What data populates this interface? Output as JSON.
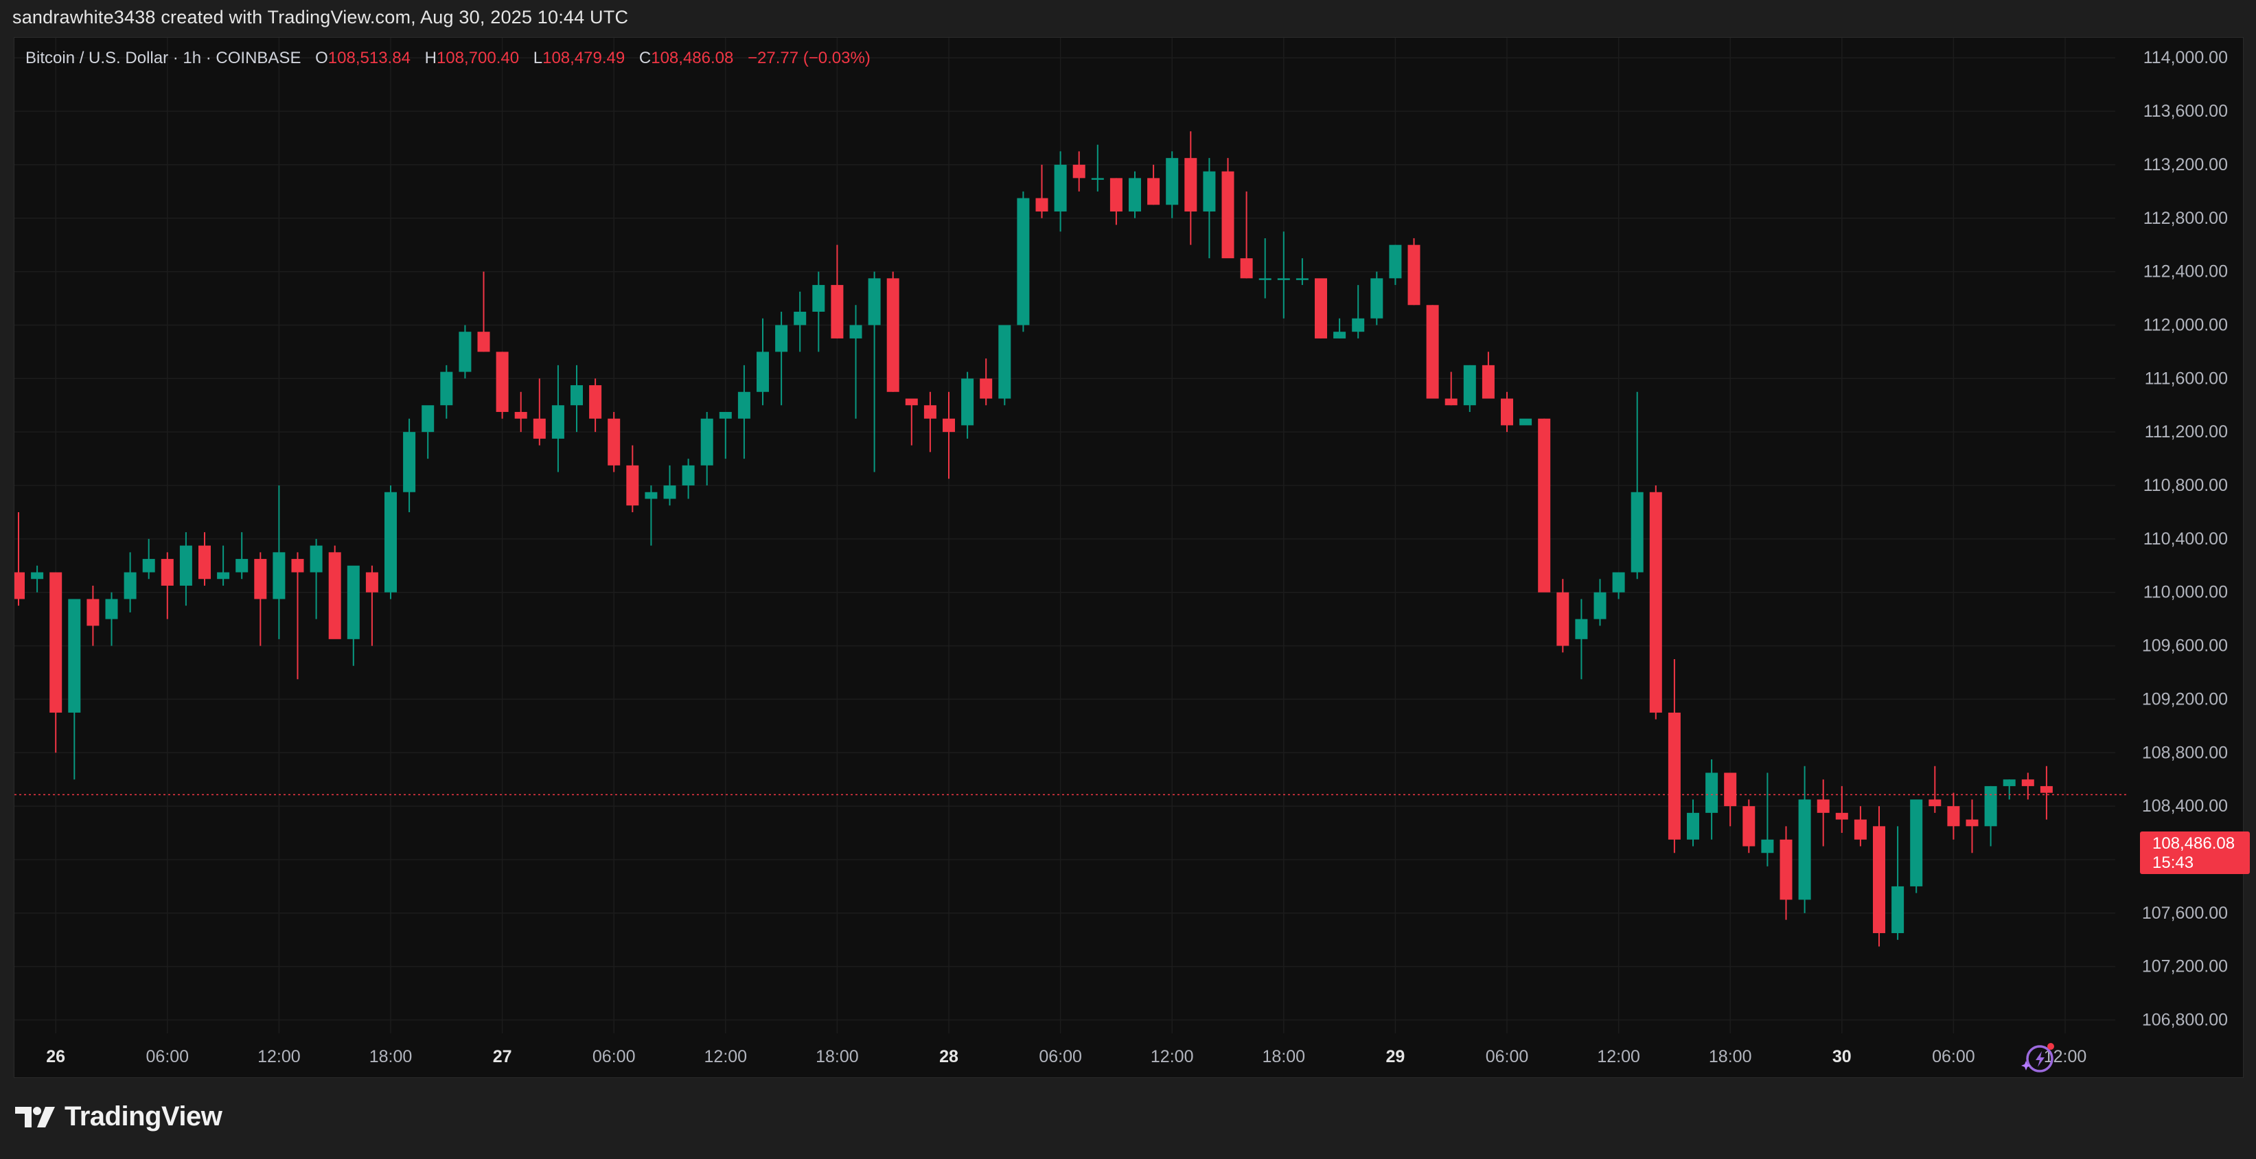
{
  "header": {
    "text": "sandrawhite3438 created with TradingView.com, Aug 30, 2025 10:44 UTC"
  },
  "legend": {
    "symbol": "Bitcoin / U.S. Dollar · 1h · COINBASE",
    "o_label": "O",
    "o_value": "108,513.84",
    "h_label": "H",
    "h_value": "108,700.40",
    "l_label": "L",
    "l_value": "108,479.49",
    "c_label": "C",
    "c_value": "108,486.08",
    "change": "−27.77 (−0.03%)"
  },
  "price_tag": {
    "price": "108,486.08",
    "countdown": "15:43"
  },
  "footer": {
    "logo_text": "TradingView"
  },
  "colors": {
    "up": "#089981",
    "down": "#f23645",
    "background": "#0f0f0f",
    "grid": "#1c1c1c",
    "text": "#b2b5be"
  },
  "icons": {
    "logo": "tradingview-logo-icon",
    "assistant": "sparkle-assistant-icon"
  },
  "chart_data": {
    "type": "candlestick",
    "interval": "1h",
    "last_price": 108486.08,
    "ylim": [
      106700,
      114150
    ],
    "y_ticks": [
      "114,000.00",
      "113,600.00",
      "113,200.00",
      "112,800.00",
      "112,400.00",
      "112,000.00",
      "111,600.00",
      "111,200.00",
      "110,800.00",
      "110,400.00",
      "110,000.00",
      "109,600.00",
      "109,200.00",
      "108,800.00",
      "108,400.00",
      "108,000.00",
      "107,600.00",
      "107,200.00",
      "106,800.00"
    ],
    "x_ticks": [
      {
        "label": "26",
        "bar": 2,
        "bold": true
      },
      {
        "label": "06:00",
        "bar": 8
      },
      {
        "label": "12:00",
        "bar": 14
      },
      {
        "label": "18:00",
        "bar": 20
      },
      {
        "label": "27",
        "bar": 26,
        "bold": true
      },
      {
        "label": "06:00",
        "bar": 32
      },
      {
        "label": "12:00",
        "bar": 38
      },
      {
        "label": "18:00",
        "bar": 44
      },
      {
        "label": "28",
        "bar": 50,
        "bold": true
      },
      {
        "label": "06:00",
        "bar": 56
      },
      {
        "label": "12:00",
        "bar": 62
      },
      {
        "label": "18:00",
        "bar": 68
      },
      {
        "label": "29",
        "bar": 74,
        "bold": true
      },
      {
        "label": "06:00",
        "bar": 80
      },
      {
        "label": "12:00",
        "bar": 86
      },
      {
        "label": "18:00",
        "bar": 92
      },
      {
        "label": "30",
        "bar": 98,
        "bold": true
      },
      {
        "label": "06:00",
        "bar": 104
      },
      {
        "label": "12:00",
        "bar": 110
      }
    ],
    "candles": [
      [
        110150,
        110600,
        109900,
        109950
      ],
      [
        110100,
        110200,
        110000,
        110150
      ],
      [
        110150,
        110150,
        108800,
        109100
      ],
      [
        109100,
        109950,
        108600,
        109950
      ],
      [
        109950,
        110050,
        109600,
        109750
      ],
      [
        109800,
        110000,
        109600,
        109950
      ],
      [
        109950,
        110300,
        109850,
        110150
      ],
      [
        110150,
        110400,
        110100,
        110250
      ],
      [
        110250,
        110300,
        109800,
        110050
      ],
      [
        110050,
        110450,
        109900,
        110350
      ],
      [
        110350,
        110450,
        110050,
        110100
      ],
      [
        110100,
        110350,
        110050,
        110150
      ],
      [
        110150,
        110450,
        110100,
        110250
      ],
      [
        110250,
        110300,
        109600,
        109950
      ],
      [
        109950,
        110800,
        109650,
        110300
      ],
      [
        110250,
        110300,
        109350,
        110150
      ],
      [
        110150,
        110400,
        109800,
        110350
      ],
      [
        110300,
        110350,
        109750,
        109650
      ],
      [
        109650,
        110050,
        109450,
        110200
      ],
      [
        110150,
        110200,
        109600,
        110000
      ],
      [
        110000,
        110800,
        109950,
        110750
      ],
      [
        110750,
        111300,
        110600,
        111200
      ],
      [
        111200,
        111350,
        111000,
        111400
      ],
      [
        111400,
        111700,
        111300,
        111650
      ],
      [
        111650,
        112000,
        111600,
        111950
      ],
      [
        111950,
        112400,
        111800,
        111800
      ],
      [
        111800,
        111800,
        111300,
        111350
      ],
      [
        111350,
        111500,
        111200,
        111300
      ],
      [
        111300,
        111600,
        111100,
        111150
      ],
      [
        111150,
        111700,
        110900,
        111400
      ],
      [
        111400,
        111700,
        111200,
        111550
      ],
      [
        111550,
        111600,
        111200,
        111300
      ],
      [
        111300,
        111350,
        110900,
        110950
      ],
      [
        110950,
        111100,
        110600,
        110650
      ],
      [
        110700,
        110800,
        110350,
        110750
      ],
      [
        110700,
        110950,
        110650,
        110800
      ],
      [
        110800,
        111000,
        110700,
        110950
      ],
      [
        110950,
        111350,
        110800,
        111300
      ],
      [
        111300,
        111350,
        111000,
        111350
      ],
      [
        111300,
        111700,
        111000,
        111500
      ],
      [
        111500,
        112050,
        111400,
        111800
      ],
      [
        111800,
        112100,
        111400,
        112000
      ],
      [
        112000,
        112250,
        111800,
        112100
      ],
      [
        112100,
        112400,
        111800,
        112300
      ],
      [
        112300,
        112600,
        111900,
        111900
      ],
      [
        111900,
        112150,
        111300,
        112000
      ],
      [
        112000,
        112400,
        110900,
        112350
      ],
      [
        112350,
        112400,
        111500,
        111500
      ],
      [
        111450,
        111450,
        111100,
        111400
      ],
      [
        111400,
        111500,
        111050,
        111300
      ],
      [
        111300,
        111500,
        110850,
        111200
      ],
      [
        111250,
        111650,
        111150,
        111600
      ],
      [
        111600,
        111750,
        111400,
        111450
      ],
      [
        111450,
        112000,
        111400,
        112000
      ],
      [
        112000,
        113000,
        111950,
        112950
      ],
      [
        112950,
        113200,
        112800,
        112850
      ],
      [
        112850,
        113300,
        112700,
        113200
      ],
      [
        113200,
        113300,
        113000,
        113100
      ],
      [
        113100,
        113350,
        113000,
        113100
      ],
      [
        113100,
        113100,
        112750,
        112850
      ],
      [
        112850,
        113150,
        112800,
        113100
      ],
      [
        113100,
        113200,
        112900,
        112900
      ],
      [
        112900,
        113300,
        112800,
        113250
      ],
      [
        113250,
        113450,
        112600,
        112850
      ],
      [
        112850,
        113250,
        112500,
        113150
      ],
      [
        113150,
        113250,
        112550,
        112500
      ],
      [
        112500,
        113000,
        112350,
        112350
      ],
      [
        112350,
        112650,
        112200,
        112350
      ],
      [
        112350,
        112700,
        112050,
        112350
      ],
      [
        112350,
        112500,
        112300,
        112350
      ],
      [
        112350,
        112300,
        111900,
        111900
      ],
      [
        111900,
        112050,
        111900,
        111950
      ],
      [
        111950,
        112300,
        111900,
        112050
      ],
      [
        112050,
        112400,
        112000,
        112350
      ],
      [
        112350,
        112600,
        112300,
        112600
      ],
      [
        112600,
        112650,
        112150,
        112150
      ],
      [
        112150,
        112150,
        111450,
        111450
      ],
      [
        111450,
        111650,
        111400,
        111400
      ],
      [
        111400,
        111700,
        111350,
        111700
      ],
      [
        111700,
        111800,
        111450,
        111450
      ],
      [
        111450,
        111500,
        111200,
        111250
      ],
      [
        111250,
        111300,
        111300,
        111300
      ],
      [
        111300,
        111300,
        110050,
        110000
      ],
      [
        110000,
        110100,
        109550,
        109600
      ],
      [
        109650,
        109950,
        109350,
        109800
      ],
      [
        109800,
        110100,
        109750,
        110000
      ],
      [
        110000,
        110150,
        109950,
        110150
      ],
      [
        110150,
        111500,
        110100,
        110750
      ],
      [
        110750,
        110800,
        109050,
        109100
      ],
      [
        109100,
        109500,
        108050,
        108150
      ],
      [
        108150,
        108450,
        108100,
        108350
      ],
      [
        108350,
        108750,
        108150,
        108650
      ],
      [
        108650,
        108650,
        108250,
        108400
      ],
      [
        108400,
        108450,
        108050,
        108100
      ],
      [
        108050,
        108650,
        107950,
        108150
      ],
      [
        108150,
        108250,
        107550,
        107700
      ],
      [
        107700,
        108700,
        107600,
        108450
      ],
      [
        108450,
        108600,
        108100,
        108350
      ],
      [
        108350,
        108550,
        108200,
        108300
      ],
      [
        108300,
        108400,
        108100,
        108150
      ],
      [
        108250,
        108400,
        107350,
        107450
      ],
      [
        107450,
        108250,
        107400,
        107800
      ],
      [
        107800,
        108400,
        107750,
        108450
      ],
      [
        108450,
        108700,
        108350,
        108400
      ],
      [
        108400,
        108500,
        108150,
        108250
      ],
      [
        108300,
        108450,
        108050,
        108250
      ],
      [
        108250,
        108550,
        108100,
        108550
      ],
      [
        108550,
        108600,
        108450,
        108600
      ],
      [
        108600,
        108650,
        108450,
        108550
      ],
      [
        108550,
        108700,
        108300,
        108500
      ]
    ]
  }
}
